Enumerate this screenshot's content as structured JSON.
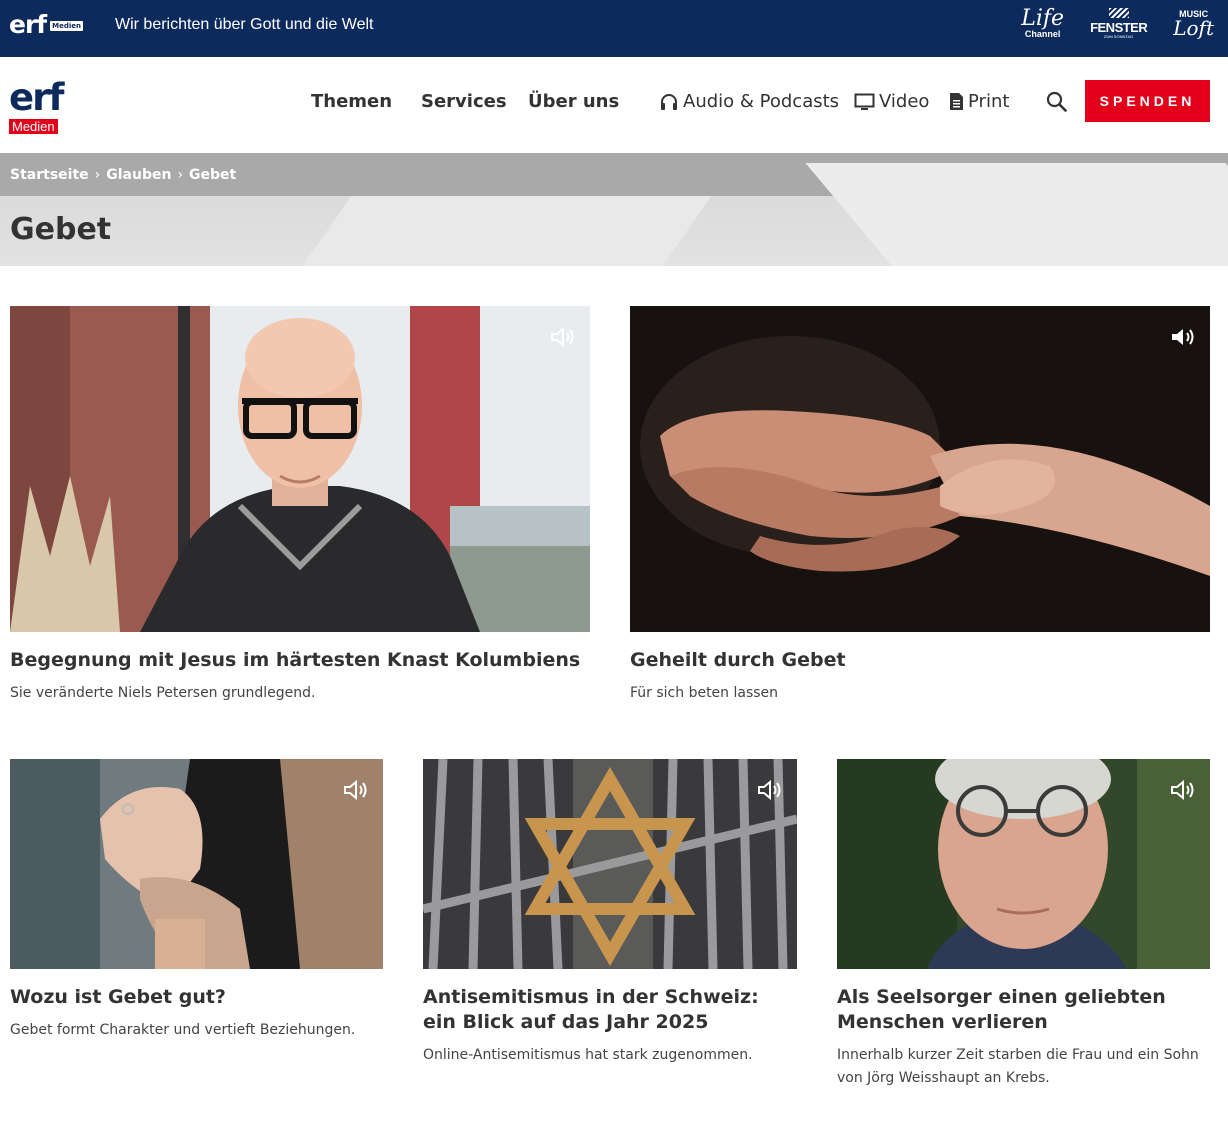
{
  "topbar": {
    "logo_text": "erf",
    "logo_sub": "Medien",
    "tagline": "Wir berichten über Gott und die Welt",
    "brands": {
      "life_1": "Life",
      "life_2": "Channel",
      "fenster_1": "FENSTER",
      "fenster_2": "ZUM SONNTAG",
      "music_1": "MUSIC",
      "music_2": "Loft"
    }
  },
  "header": {
    "logo_text": "erf",
    "logo_sub": "Medien",
    "nav": {
      "themen": "Themen",
      "services": "Services",
      "ueber": "Über uns",
      "audio": "Audio & Podcasts",
      "video": "Video",
      "print": "Print"
    },
    "donate": "SPENDEN"
  },
  "breadcrumb": [
    "Startseite",
    "Glauben",
    "Gebet"
  ],
  "breadcrumb_sep": "›",
  "page_title": "Gebet",
  "cards": [
    {
      "title": "Begegnung mit Jesus im härtesten Knast Kolumbiens",
      "desc": "Sie veränderte Niels Petersen grundlegend."
    },
    {
      "title": "Geheilt durch Gebet",
      "desc": "Für sich beten lassen"
    },
    {
      "title": "Wozu ist Gebet gut?",
      "desc": "Gebet formt Charakter und vertieft Beziehungen."
    },
    {
      "title": "Antisemitismus in der Schweiz: ein Blick auf das Jahr 2025",
      "desc": "Online-Antisemitismus hat stark zugenommen."
    },
    {
      "title": "Als Seelsorger einen geliebten Menschen verlieren",
      "desc": "Innerhalb kurzer Zeit starben die Frau und ein Sohn von Jörg Weisshaupt an Krebs."
    }
  ],
  "colors": {
    "navy": "#0d2a5c",
    "red": "#e2001a",
    "text": "#333333"
  },
  "icons": [
    "headphones-icon",
    "monitor-icon",
    "document-icon",
    "search-icon",
    "audio-speaker-icon"
  ]
}
